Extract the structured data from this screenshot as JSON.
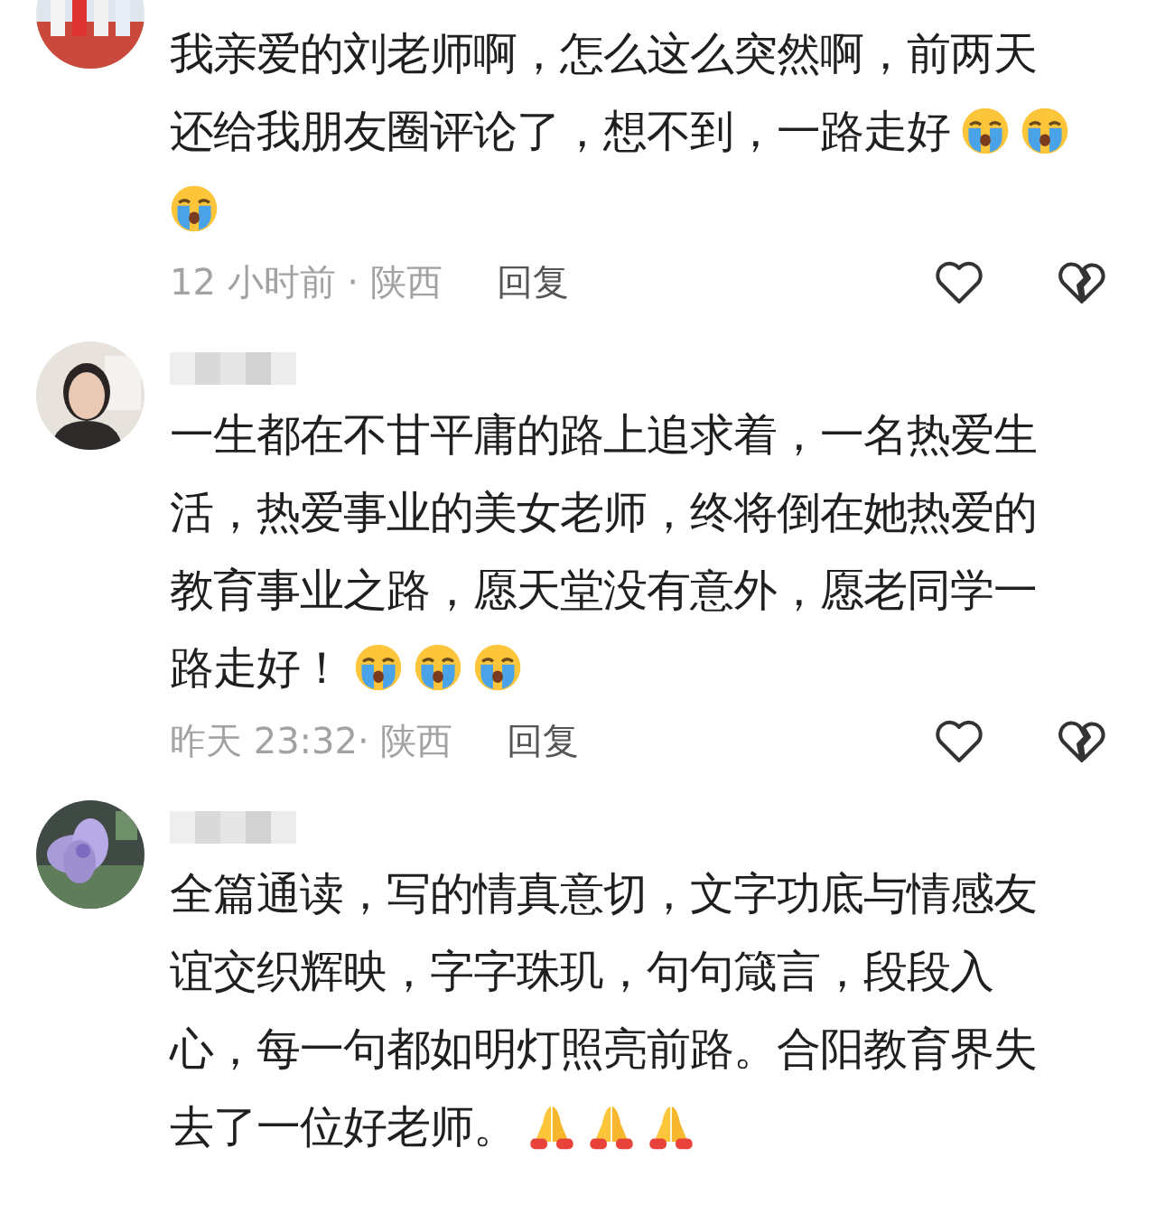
{
  "comments": [
    {
      "avatar": {
        "kind": "crowd"
      },
      "name_blurred": false,
      "lines": [
        {
          "text": "我亲爱的刘老师啊，怎么这么突然啊，前两天"
        },
        {
          "text": "还给我朋友圈评论了，想不到，一路走好",
          "emojis": [
            {
              "kind": "crying"
            },
            {
              "kind": "crying"
            }
          ]
        },
        {
          "emojis": [
            {
              "kind": "crying"
            }
          ]
        }
      ],
      "meta": "12 小时前 · 陕西",
      "reply": "回复"
    },
    {
      "avatar": {
        "kind": "person"
      },
      "name_blurred": true,
      "lines": [
        {
          "text": "一生都在不甘平庸的路上追求着，一名热爱生"
        },
        {
          "text": "活，热爱事业的美女老师，终将倒在她热爱的"
        },
        {
          "text": "教育事业之路，愿天堂没有意外，愿老同学一"
        },
        {
          "text": "路走好！",
          "emojis": [
            {
              "kind": "crying"
            },
            {
              "kind": "crying"
            },
            {
              "kind": "crying"
            }
          ]
        }
      ],
      "meta": "昨天 23:32· 陕西",
      "reply": "回复"
    },
    {
      "avatar": {
        "kind": "flower"
      },
      "name_blurred": true,
      "lines": [
        {
          "text": "全篇通读，写的情真意切，文字功底与情感友"
        },
        {
          "text": "谊交织辉映，字字珠玑，句句箴言，段段入"
        },
        {
          "text": "心，每一句都如明灯照亮前路。合阳教育界失"
        },
        {
          "text": "去了一位好老师。",
          "emojis": [
            {
              "kind": "praying"
            },
            {
              "kind": "praying"
            },
            {
              "kind": "praying"
            }
          ]
        }
      ]
    }
  ]
}
